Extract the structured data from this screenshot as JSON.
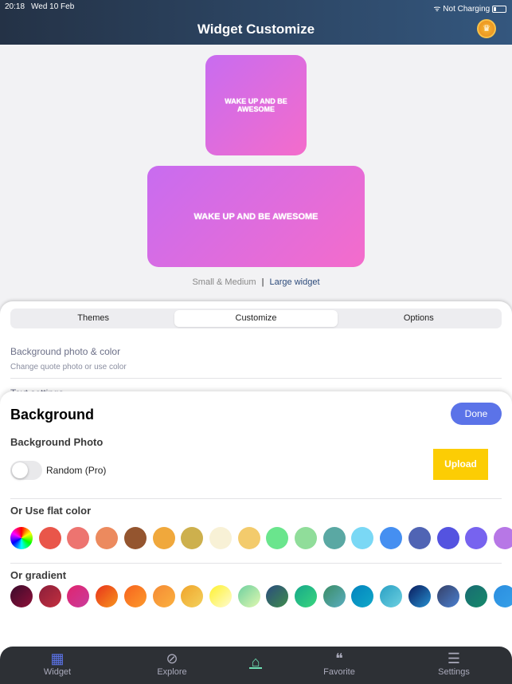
{
  "status": {
    "time": "20:18",
    "date": "Wed 10 Feb",
    "charging": "Not Charging"
  },
  "header": {
    "title": "Widget Customize",
    "crown_icon": "crown-icon"
  },
  "preview": {
    "small_text": "Wake up and be awesome",
    "large_text": "Wake up and be awesome",
    "size_small_medium": "Small & Medium",
    "size_large": "Large widget"
  },
  "segments": [
    "Themes",
    "Customize",
    "Options"
  ],
  "selected_segment": "Customize",
  "customize": {
    "item_title": "Background photo & color",
    "item_subtitle": "Change quote photo or use color",
    "next_item_partial": "Text settings"
  },
  "background": {
    "title": "Background",
    "done": "Done",
    "photo_label": "Background Photo",
    "random_label": "Random (Pro)",
    "random_on": false,
    "upload": "Upload",
    "flat_label": "Or Use flat color",
    "gradient_label": "Or gradient",
    "flat_colors": [
      "rainbow",
      "#e9564a",
      "#ed7470",
      "#ec8a5e",
      "#94552f",
      "#f0a83c",
      "#cdb04d",
      "#f8f1d6",
      "#f3cb6c",
      "#6ae58d",
      "#90dd9a",
      "#5aa8a3",
      "#7ad8f5",
      "#458ff1",
      "#5064b4",
      "#5453e0",
      "#7763ef",
      "#b777e6"
    ],
    "gradients": [
      [
        "#3a0b2c",
        "#8e1038"
      ],
      [
        "#8a1e3a",
        "#c4303f"
      ],
      [
        "#e0246e",
        "#c93c9c"
      ],
      [
        "#e8341c",
        "#f7941d"
      ],
      [
        "#f7631e",
        "#fc9a2c"
      ],
      [
        "#f58a35",
        "#fbb13f"
      ],
      [
        "#f0a42b",
        "#f3d15c"
      ],
      [
        "#fdf12e",
        "#fffbd0"
      ],
      [
        "#6fd0a0",
        "#e0f8b0"
      ],
      [
        "#2b4c7e",
        "#3f8c4c"
      ],
      [
        "#16a88a",
        "#3ad67e"
      ],
      [
        "#3b8c66",
        "#5aaec0"
      ],
      [
        "#0383bf",
        "#10a8c8"
      ],
      [
        "#2aa0c4",
        "#6dd0e0"
      ],
      [
        "#0a1a5c",
        "#2690d0"
      ],
      [
        "#364068",
        "#4a80d0"
      ],
      [
        "#196b73",
        "#168a6a"
      ],
      [
        "#2b8ee0",
        "#36a0e8"
      ]
    ]
  },
  "tabbar": [
    {
      "label": "Widget",
      "icon": "grid-icon"
    },
    {
      "label": "Explore",
      "icon": "compass-icon"
    },
    {
      "label": "",
      "icon": "home-icon"
    },
    {
      "label": "Favorite",
      "icon": "quote-icon"
    },
    {
      "label": "Settings",
      "icon": "sliders-icon"
    }
  ],
  "colors": {
    "accent": "#5b73e8",
    "upload": "#fccd04",
    "home_active": "#6ee0b4"
  }
}
